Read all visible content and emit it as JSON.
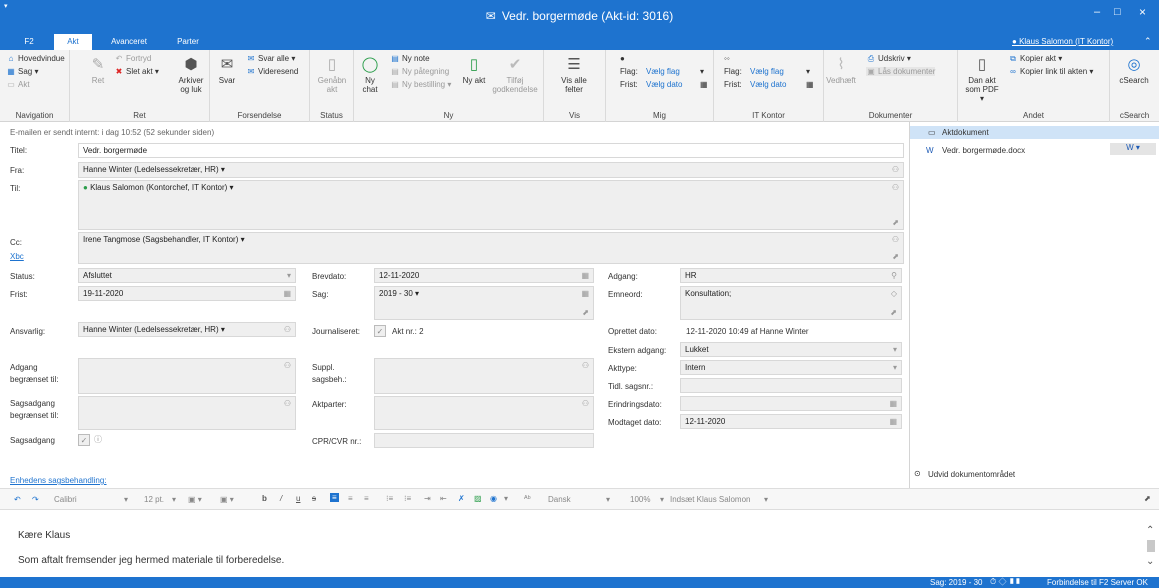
{
  "window": {
    "title": "Vedr. borgermøde (Akt-id: 3016)",
    "minimize": "–",
    "maximize": "□",
    "close": "×"
  },
  "tabs": [
    "F2",
    "Akt",
    "Avanceret",
    "Parter"
  ],
  "user": "Klaus Salomon (IT Kontor)",
  "ribbon": {
    "navigation": {
      "label": "Navigation",
      "items": [
        "Hovedvindue",
        "Sag",
        "Akt"
      ]
    },
    "ret": {
      "label": "Ret",
      "ret": "Ret",
      "fortryd": "Fortryd",
      "slet_akt": "Slet akt",
      "arkiver": "Arkiver og luk"
    },
    "forsendelse": {
      "label": "Forsendelse",
      "svar": "Svar",
      "svar_alle": "Svar alle",
      "videresend": "Videresend"
    },
    "status": {
      "label": "Status",
      "genaabn": "Genåbn akt"
    },
    "ny": {
      "label": "Ny",
      "ny_chat": "Ny chat",
      "ny_note": "Ny note",
      "ny_paategning": "Ny påtegning",
      "ny_bestilling": "Ny bestilling",
      "ny_akt": "Ny akt",
      "tilfoej": "Tilføj godkendelse"
    },
    "vis": {
      "label": "Vis",
      "vis_alle": "Vis alle felter"
    },
    "mig": {
      "label": "Mig",
      "flag": "Flag:",
      "flag_val": "Vælg flag",
      "frist": "Frist:",
      "frist_val": "Vælg dato"
    },
    "itkontor": {
      "label": "IT Kontor",
      "flag": "Flag:",
      "flag_val": "Vælg flag",
      "frist": "Frist:",
      "frist_val": "Vælg dato"
    },
    "dokumenter": {
      "label": "Dokumenter",
      "vedhaeft": "Vedhæft",
      "udskriv": "Udskriv",
      "laas": "Lås dokumenter"
    },
    "andet": {
      "label": "Andet",
      "dan_akt": "Dan akt som PDF",
      "kopier_akt": "Kopier akt",
      "kopier_link": "Kopier link til akten"
    },
    "csearch": {
      "label": "cSearch",
      "btn": "cSearch"
    }
  },
  "form": {
    "sent_info": "E-mailen er sendt internt:   i dag 10:52 (52 sekunder siden)",
    "titel_label": "Titel:",
    "titel": "Vedr. borgermøde",
    "fra_label": "Fra:",
    "fra": "Hanne Winter (Ledelsessekretær, HR) ▾",
    "til_label": "Til:",
    "til": "Klaus Salomon (Kontorchef, IT Kontor) ▾",
    "cc_label": "Cc:",
    "cc": "Irene Tangmose (Sagsbehandler, IT Kontor) ▾",
    "xbc": "Xbc",
    "status_label": "Status:",
    "status": "Afsluttet",
    "frist_label": "Frist:",
    "frist": "19-11-2020",
    "ansvarlig_label": "Ansvarlig:",
    "ansvarlig": "Hanne Winter (Ledelsessekretær, HR) ▾",
    "adgang_begr_label": "Adgang begrænset til:",
    "sagsadgang_begr_label": "Sagsadgang begrænset til:",
    "sagsadgang_label": "Sagsadgang",
    "brevdato_label": "Brevdato:",
    "brevdato": "12-11-2020",
    "sag_label": "Sag:",
    "sag": "2019 - 30 ▾",
    "journaliseret_label": "Journaliseret:",
    "akt_nr": "Akt nr.:  2",
    "suppl_label": "Suppl. sagsbeh.:",
    "aktparter_label": "Aktparter:",
    "cpr_label": "CPR/CVR nr.:",
    "adgang_label": "Adgang:",
    "adgang": "HR",
    "emneord_label": "Emneord:",
    "emneord": "Konsultation;",
    "oprettet_label": "Oprettet dato:",
    "oprettet": "12-11-2020 10:49   af   Hanne Winter",
    "ekstern_label": "Ekstern adgang:",
    "ekstern": "Lukket",
    "akttype_label": "Akttype:",
    "akttype": "Intern",
    "tidl_label": "Tidl. sagsnr.:",
    "erindring_label": "Erindringsdato:",
    "modtaget_label": "Modtaget dato:",
    "modtaget": "12-11-2020",
    "enhedens": "Enhedens sagsbehandling:"
  },
  "docs": {
    "header": "Aktdokument",
    "file": "Vedr. borgermøde.docx",
    "expand": "Udvid dokumentområdet"
  },
  "format": {
    "font": "Calibri",
    "size": "12 pt.",
    "lang": "Dansk",
    "zoom": "100%",
    "indsat": "Indsæt Klaus Salomon"
  },
  "body": {
    "line1": "Kære Klaus",
    "line2": "Som aftalt fremsender jeg hermed materiale til forberedelse."
  },
  "statusbar": {
    "sag": "Sag: 2019 - 30",
    "conn": "Forbindelse til F2 Server OK"
  }
}
